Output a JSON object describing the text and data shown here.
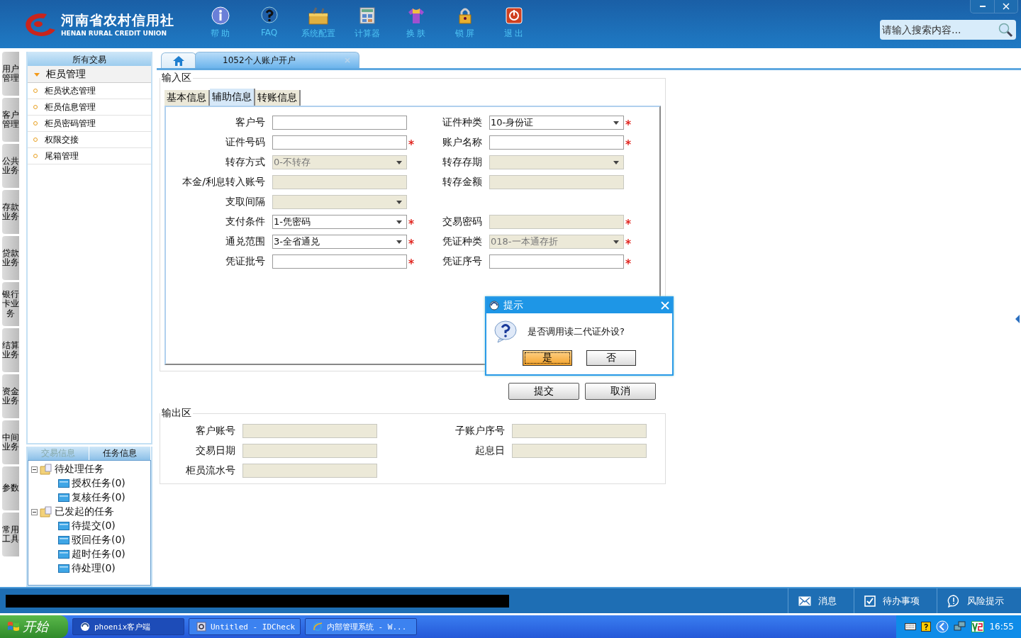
{
  "header": {
    "logo_cn": "河南省农村信用社",
    "logo_en": "HENAN RURAL CREDIT UNION",
    "toolbar": [
      {
        "label": "帮 助",
        "kind": "info"
      },
      {
        "label": "FAQ",
        "kind": "faq"
      },
      {
        "label": "系统配置",
        "kind": "config"
      },
      {
        "label": "计算器",
        "kind": "calc"
      },
      {
        "label": "换 肤",
        "kind": "skin"
      },
      {
        "label": "锁 屏",
        "kind": "lock"
      },
      {
        "label": "退 出",
        "kind": "exit"
      }
    ],
    "search": {
      "placeholder": "请输入搜索内容..."
    }
  },
  "side_tabs": [
    "用户管理",
    "客户管理",
    "公共业务",
    "存款业务",
    "贷款业务",
    "银行卡业务",
    "结算业务",
    "资金业务",
    "中间业务",
    "参数",
    "常用工具"
  ],
  "sidebar": {
    "title": "所有交易",
    "group": {
      "label": "柜员管理",
      "expanded": true
    },
    "items": [
      "柜员状态管理",
      "柜员信息管理",
      "柜员密码管理",
      "权限交接",
      "尾箱管理"
    ],
    "bottom_tabs": [
      {
        "label": "交易信息",
        "selected": false
      },
      {
        "label": "任务信息",
        "selected": true
      }
    ],
    "tree": [
      {
        "label": "待处理任务",
        "expanded": true,
        "children": [
          {
            "label": "授权任务(0)"
          },
          {
            "label": "复核任务(0)"
          }
        ]
      },
      {
        "label": "已发起的任务",
        "expanded": true,
        "children": [
          {
            "label": "待提交(0)"
          },
          {
            "label": "驳回任务(0)"
          },
          {
            "label": "超时任务(0)"
          },
          {
            "label": "待处理(0)"
          }
        ]
      }
    ]
  },
  "page_tabs": [
    {
      "kind": "home",
      "selected": false
    },
    {
      "kind": "page",
      "label": "1052个人账户开户",
      "selected": true
    }
  ],
  "input_area": {
    "title": "输入区",
    "tabs": [
      {
        "label": "基本信息",
        "selected": false
      },
      {
        "label": "辅助信息",
        "selected": true
      },
      {
        "label": "转账信息",
        "selected": false
      }
    ],
    "rows": [
      [
        {
          "label": "客户号",
          "kind": "text",
          "disabled": false,
          "required": false
        },
        {
          "label": "证件种类",
          "kind": "select",
          "value": "10-身份证",
          "disabled": false,
          "required": true
        }
      ],
      [
        {
          "label": "证件号码",
          "kind": "text",
          "disabled": false,
          "required": true
        },
        {
          "label": "账户名称",
          "kind": "text",
          "disabled": false,
          "required": true
        }
      ],
      [
        {
          "label": "转存方式",
          "kind": "select",
          "value": "0-不转存",
          "disabled": true,
          "required": false
        },
        {
          "label": "转存存期",
          "kind": "select",
          "disabled": true,
          "required": false
        }
      ],
      [
        {
          "label": "本金/利息转入账号",
          "kind": "text",
          "disabled": true,
          "required": false
        },
        {
          "label": "转存金额",
          "kind": "text",
          "disabled": true,
          "required": false
        }
      ],
      [
        {
          "label": "支取间隔",
          "kind": "select",
          "disabled": true,
          "required": false
        }
      ],
      [
        {
          "label": "支付条件",
          "kind": "select",
          "value": "1-凭密码",
          "disabled": false,
          "required": true
        },
        {
          "label": "交易密码",
          "kind": "text",
          "disabled": true,
          "required": true
        }
      ],
      [
        {
          "label": "通兑范围",
          "kind": "select",
          "value": "3-全省通兑",
          "disabled": false,
          "required": true
        },
        {
          "label": "凭证种类",
          "kind": "select",
          "value": "018-一本通存折",
          "disabled": true,
          "required": true
        }
      ],
      [
        {
          "label": "凭证批号",
          "kind": "text",
          "disabled": false,
          "required": true
        },
        {
          "label": "凭证序号",
          "kind": "text",
          "disabled": false,
          "required": true
        }
      ]
    ]
  },
  "actions": [
    "提交",
    "取消"
  ],
  "output_area": {
    "title": "输出区",
    "rows": [
      [
        {
          "label": "客户账号",
          "disabled": true
        },
        {
          "label": "子账户序号",
          "disabled": true
        }
      ],
      [
        {
          "label": "交易日期",
          "disabled": true
        },
        {
          "label": "起息日",
          "disabled": true
        }
      ],
      [
        {
          "label": "柜员流水号",
          "disabled": true
        }
      ]
    ]
  },
  "dialog": {
    "title": "提示",
    "message": "是否调用读二代证外设?",
    "buttons": [
      {
        "label": "是",
        "selected": true
      },
      {
        "label": "否",
        "selected": false
      }
    ]
  },
  "status_bar": [
    {
      "label": "消息",
      "kind": "mail"
    },
    {
      "label": "待办事项",
      "kind": "check"
    },
    {
      "label": "风险提示",
      "kind": "alert"
    }
  ],
  "taskbar": {
    "start": "开始",
    "items": [
      {
        "label": "phoenix客户端",
        "kind": "app",
        "selected": true
      },
      {
        "label": "Untitled - IDCheck",
        "kind": "check",
        "selected": false
      },
      {
        "label": "内部管理系统 - W...",
        "kind": "ie",
        "selected": false
      }
    ],
    "time": "16:55"
  }
}
